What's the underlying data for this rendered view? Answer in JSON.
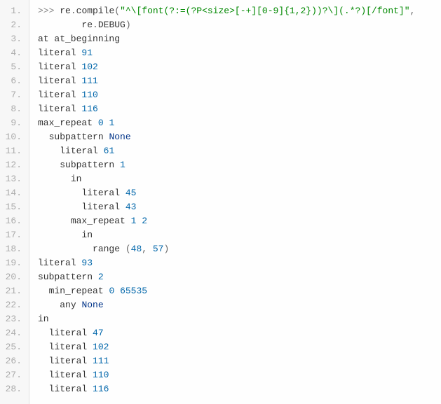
{
  "lines": [
    {
      "num": "1.",
      "indent": 0,
      "segments": [
        {
          "t": ">>> ",
          "c": "prompt"
        },
        {
          "t": "re",
          "c": "identifier"
        },
        {
          "t": ".",
          "c": "punct"
        },
        {
          "t": "compile",
          "c": "func"
        },
        {
          "t": "(",
          "c": "punct"
        },
        {
          "t": "\"^\\[font(?:=(?P<size>[-+][0-9]{1,2}))?\\](.*?)[/font]\"",
          "c": "string"
        },
        {
          "t": ",",
          "c": "punct"
        }
      ]
    },
    {
      "num": "2.",
      "indent": 8,
      "segments": [
        {
          "t": "re",
          "c": "identifier"
        },
        {
          "t": ".",
          "c": "punct"
        },
        {
          "t": "DEBUG",
          "c": "identifier"
        },
        {
          "t": ")",
          "c": "punct"
        }
      ]
    },
    {
      "num": "3.",
      "indent": 0,
      "segments": [
        {
          "t": "at at_beginning",
          "c": "kw"
        }
      ]
    },
    {
      "num": "4.",
      "indent": 0,
      "segments": [
        {
          "t": "literal ",
          "c": "kw"
        },
        {
          "t": "91",
          "c": "number"
        }
      ]
    },
    {
      "num": "5.",
      "indent": 0,
      "segments": [
        {
          "t": "literal ",
          "c": "kw"
        },
        {
          "t": "102",
          "c": "number"
        }
      ]
    },
    {
      "num": "6.",
      "indent": 0,
      "segments": [
        {
          "t": "literal ",
          "c": "kw"
        },
        {
          "t": "111",
          "c": "number"
        }
      ]
    },
    {
      "num": "7.",
      "indent": 0,
      "segments": [
        {
          "t": "literal ",
          "c": "kw"
        },
        {
          "t": "110",
          "c": "number"
        }
      ]
    },
    {
      "num": "8.",
      "indent": 0,
      "segments": [
        {
          "t": "literal ",
          "c": "kw"
        },
        {
          "t": "116",
          "c": "number"
        }
      ]
    },
    {
      "num": "9.",
      "indent": 0,
      "segments": [
        {
          "t": "max_repeat ",
          "c": "kw"
        },
        {
          "t": "0",
          "c": "number"
        },
        {
          "t": " ",
          "c": "kw"
        },
        {
          "t": "1",
          "c": "number"
        }
      ]
    },
    {
      "num": "10.",
      "indent": 2,
      "segments": [
        {
          "t": "subpattern ",
          "c": "kw"
        },
        {
          "t": "None",
          "c": "keyword-none"
        }
      ]
    },
    {
      "num": "11.",
      "indent": 4,
      "segments": [
        {
          "t": "literal ",
          "c": "kw"
        },
        {
          "t": "61",
          "c": "number"
        }
      ]
    },
    {
      "num": "12.",
      "indent": 4,
      "segments": [
        {
          "t": "subpattern ",
          "c": "kw"
        },
        {
          "t": "1",
          "c": "number"
        }
      ]
    },
    {
      "num": "13.",
      "indent": 6,
      "segments": [
        {
          "t": "in",
          "c": "kw"
        }
      ]
    },
    {
      "num": "14.",
      "indent": 8,
      "segments": [
        {
          "t": "literal ",
          "c": "kw"
        },
        {
          "t": "45",
          "c": "number"
        }
      ]
    },
    {
      "num": "15.",
      "indent": 8,
      "segments": [
        {
          "t": "literal ",
          "c": "kw"
        },
        {
          "t": "43",
          "c": "number"
        }
      ]
    },
    {
      "num": "16.",
      "indent": 6,
      "segments": [
        {
          "t": "max_repeat ",
          "c": "kw"
        },
        {
          "t": "1",
          "c": "number"
        },
        {
          "t": " ",
          "c": "kw"
        },
        {
          "t": "2",
          "c": "number"
        }
      ]
    },
    {
      "num": "17.",
      "indent": 8,
      "segments": [
        {
          "t": "in",
          "c": "kw"
        }
      ]
    },
    {
      "num": "18.",
      "indent": 10,
      "segments": [
        {
          "t": "range ",
          "c": "kw"
        },
        {
          "t": "(",
          "c": "punct"
        },
        {
          "t": "48",
          "c": "number"
        },
        {
          "t": ", ",
          "c": "punct"
        },
        {
          "t": "57",
          "c": "number"
        },
        {
          "t": ")",
          "c": "punct"
        }
      ]
    },
    {
      "num": "19.",
      "indent": 0,
      "segments": [
        {
          "t": "literal ",
          "c": "kw"
        },
        {
          "t": "93",
          "c": "number"
        }
      ]
    },
    {
      "num": "20.",
      "indent": 0,
      "segments": [
        {
          "t": "subpattern ",
          "c": "kw"
        },
        {
          "t": "2",
          "c": "number"
        }
      ]
    },
    {
      "num": "21.",
      "indent": 2,
      "segments": [
        {
          "t": "min_repeat ",
          "c": "kw"
        },
        {
          "t": "0",
          "c": "number"
        },
        {
          "t": " ",
          "c": "kw"
        },
        {
          "t": "65535",
          "c": "number"
        }
      ]
    },
    {
      "num": "22.",
      "indent": 4,
      "segments": [
        {
          "t": "any ",
          "c": "kw"
        },
        {
          "t": "None",
          "c": "keyword-none"
        }
      ]
    },
    {
      "num": "23.",
      "indent": 0,
      "segments": [
        {
          "t": "in",
          "c": "kw"
        }
      ]
    },
    {
      "num": "24.",
      "indent": 2,
      "segments": [
        {
          "t": "literal ",
          "c": "kw"
        },
        {
          "t": "47",
          "c": "number"
        }
      ]
    },
    {
      "num": "25.",
      "indent": 2,
      "segments": [
        {
          "t": "literal ",
          "c": "kw"
        },
        {
          "t": "102",
          "c": "number"
        }
      ]
    },
    {
      "num": "26.",
      "indent": 2,
      "segments": [
        {
          "t": "literal ",
          "c": "kw"
        },
        {
          "t": "111",
          "c": "number"
        }
      ]
    },
    {
      "num": "27.",
      "indent": 2,
      "segments": [
        {
          "t": "literal ",
          "c": "kw"
        },
        {
          "t": "110",
          "c": "number"
        }
      ]
    },
    {
      "num": "28.",
      "indent": 2,
      "segments": [
        {
          "t": "literal ",
          "c": "kw"
        },
        {
          "t": "116",
          "c": "number"
        }
      ]
    }
  ]
}
